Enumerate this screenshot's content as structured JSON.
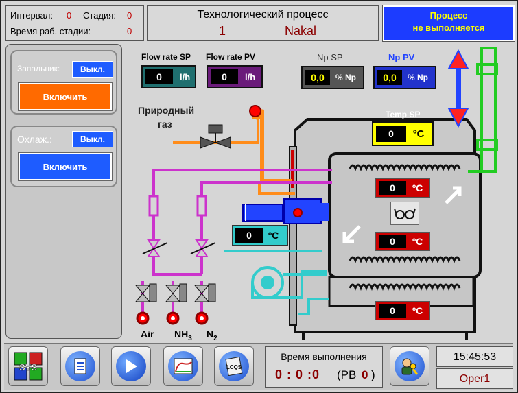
{
  "header": {
    "interval_label": "Интервал:",
    "interval_value": "0",
    "stage_label": "Стадия:",
    "stage_value": "0",
    "stage_time_label": "Время раб. стадии:",
    "stage_time_value": "0",
    "process_title": "Технологический процесс",
    "process_number": "1",
    "process_name": "Nakal",
    "status_line1": "Процесс",
    "status_line2": "не выполняется"
  },
  "controls": {
    "igniter_label": "Запальник:",
    "igniter_state": "Выкл.",
    "igniter_button": "Включить",
    "cooling_label": "Охлаж.:",
    "cooling_state": "Выкл.",
    "cooling_button": "Включить"
  },
  "setpoints": {
    "flow_sp_label": "Flow rate SP",
    "flow_sp_value": "0",
    "flow_sp_unit": "l/h",
    "flow_pv_label": "Flow rate PV",
    "flow_pv_value": "0",
    "flow_pv_unit": "l/h",
    "np_sp_label": "Np SP",
    "np_sp_value": "0,0",
    "np_sp_unit": "% Np",
    "np_pv_label": "Np PV",
    "np_pv_value": "0,0",
    "np_pv_unit": "% Np",
    "temp_sp_label": "Temp SP",
    "temp_sp_value": "0",
    "temp_sp_unit": "ºC"
  },
  "diagram": {
    "gas_label_1": "Природный",
    "gas_label_2": "газ",
    "air_label": "Air",
    "nh3_label": "NH",
    "nh3_sub": "3",
    "n2_label": "N",
    "n2_sub": "2",
    "temp_top_value": "0",
    "temp_mid_value": "0",
    "temp_bottom_value": "0",
    "temp_cyan_value": "0",
    "temp_unit": "ºC"
  },
  "footer": {
    "exec_time_label": "Время выполнения",
    "exec_time_value": "0 : 0 :0",
    "rb_label": "(РВ",
    "rb_value": "0",
    "rb_close": ")",
    "clock": "15:45:53",
    "operator": "Oper1",
    "logo_text": "SYS",
    "lcqs_text": "LCQS"
  },
  "colors": {
    "orange_button": "#ff6a00",
    "blue_button": "#1e5cff",
    "status_text": "#ffff00",
    "status_bg": "#1c3cff",
    "magenta_pipe": "#cc33cc",
    "orange_pipe": "#ff8c1a",
    "cyan_pipe": "#33cccc"
  }
}
